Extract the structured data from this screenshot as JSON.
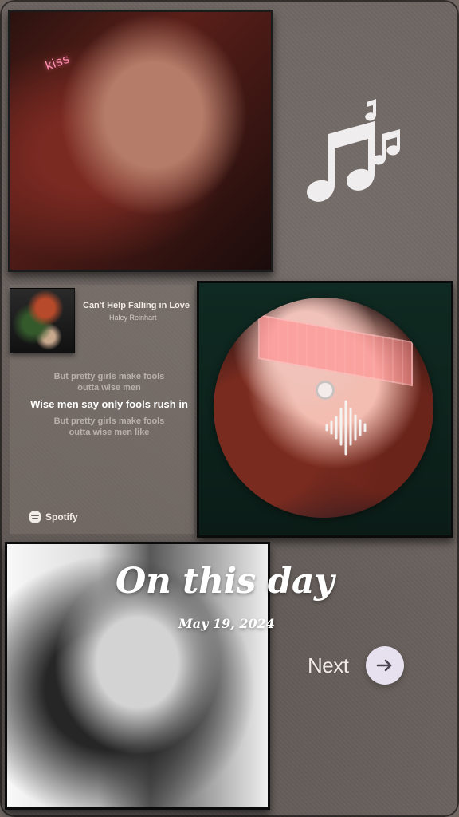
{
  "photo1": {
    "overlay_text": "kiss"
  },
  "spotify_card": {
    "song_title": "Can't Help Falling in Love",
    "artist": "Haley Reinhart",
    "lyrics": [
      "But pretty girls make fools",
      "outta wise men",
      "Wise men say only fools rush in",
      "But pretty girls make fools",
      "outta wise men like"
    ],
    "brand": "Spotify"
  },
  "overlay": {
    "title": "On this day",
    "date": "May 19, 2024"
  },
  "cta": {
    "next_label": "Next"
  },
  "icons": {
    "music_notes": "music-notes-icon",
    "waveform": "audio-waveform-icon",
    "next_arrow": "arrow-right-icon",
    "spotify_logo": "spotify-logo-icon"
  },
  "colors": {
    "background": "#6c6460",
    "accent_button": "#e7e0ef",
    "text_light": "#f1ebe7"
  }
}
